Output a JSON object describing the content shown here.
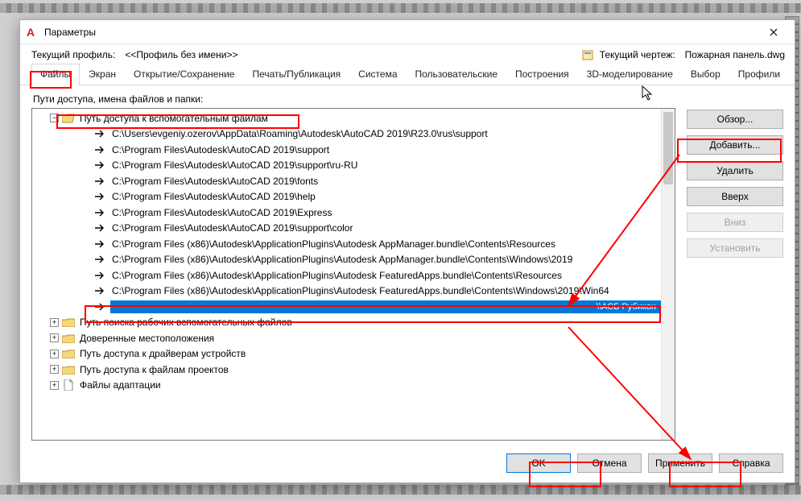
{
  "window": {
    "title": "Параметры"
  },
  "header": {
    "profile_label": "Текущий профиль:",
    "profile_value": "<<Профиль без имени>>",
    "drawing_label": "Текущий чертеж:",
    "drawing_value": "Пожарная панель.dwg"
  },
  "tabs": [
    "Файлы",
    "Экран",
    "Открытие/Сохранение",
    "Печать/Публикация",
    "Система",
    "Пользовательские",
    "Построения",
    "3D-моделирование",
    "Выбор",
    "Профили"
  ],
  "section_label": "Пути доступа, имена файлов и папки:",
  "tree": {
    "root_label": "Путь доступа к вспомогательным файлам",
    "paths": [
      "C:\\Users\\evgeniy.ozerov\\AppData\\Roaming\\Autodesk\\AutoCAD 2019\\R23.0\\rus\\support",
      "C:\\Program Files\\Autodesk\\AutoCAD 2019\\support",
      "C:\\Program Files\\Autodesk\\AutoCAD 2019\\support\\ru-RU",
      "C:\\Program Files\\Autodesk\\AutoCAD 2019\\fonts",
      "C:\\Program Files\\Autodesk\\AutoCAD 2019\\help",
      "C:\\Program Files\\Autodesk\\AutoCAD 2019\\Express",
      "C:\\Program Files\\Autodesk\\AutoCAD 2019\\support\\color",
      "C:\\Program Files (x86)\\Autodesk\\ApplicationPlugins\\Autodesk AppManager.bundle\\Contents\\Resources",
      "C:\\Program Files (x86)\\Autodesk\\ApplicationPlugins\\Autodesk AppManager.bundle\\Contents\\Windows\\2019",
      "C:\\Program Files (x86)\\Autodesk\\ApplicationPlugins\\Autodesk FeaturedApps.bundle\\Contents\\Resources",
      "C:\\Program Files (x86)\\Autodesk\\ApplicationPlugins\\Autodesk FeaturedApps.bundle\\Contents\\Windows\\2019\\Win64"
    ],
    "selected_path_label": "\\\\АСБ Рубикон",
    "siblings": [
      "Путь поиска рабочих вспомогательных файлов",
      "Доверенные местоположения",
      "Путь доступа к драйверам устройств",
      "Путь доступа к файлам проектов",
      "Файлы адаптации"
    ]
  },
  "side_buttons": {
    "browse": "Обзор...",
    "add": "Добавить...",
    "delete": "Удалить",
    "up": "Вверх",
    "down": "Вниз",
    "set": "Установить"
  },
  "bottom_buttons": {
    "ok": "OK",
    "cancel": "Отмена",
    "apply": "Применить",
    "help": "Справка"
  }
}
